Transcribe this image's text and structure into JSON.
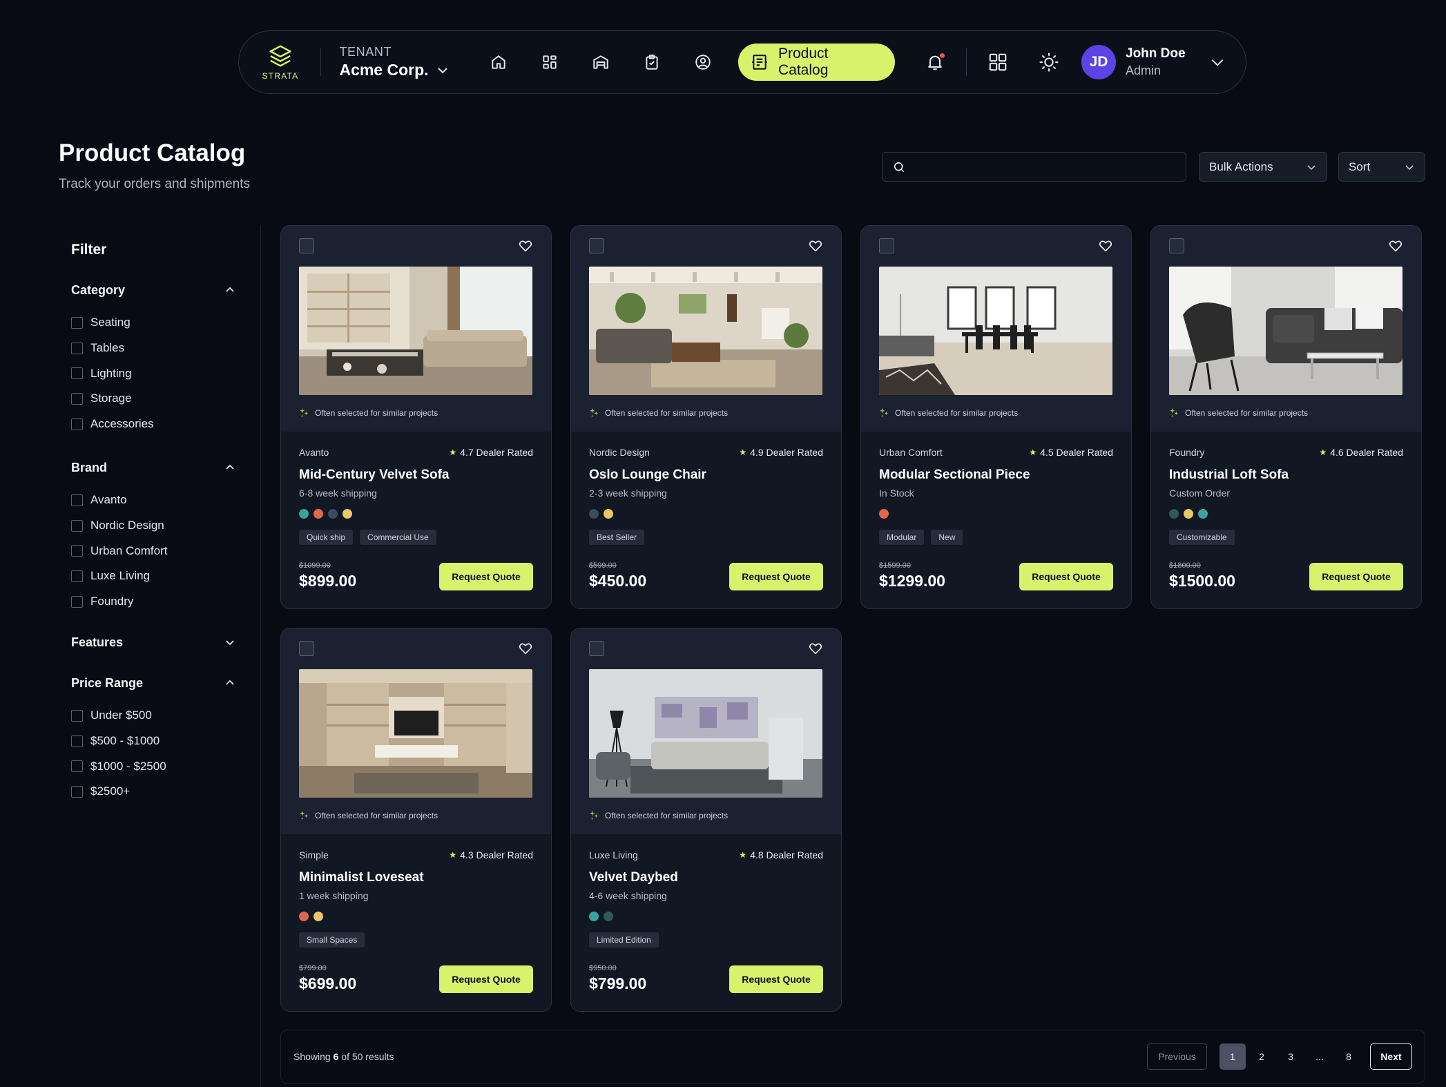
{
  "nav": {
    "logo_text": "STRATA",
    "tenant_label": "TENANT",
    "tenant_name": "Acme Corp.",
    "active_label": "Product Catalog",
    "user_initials": "JD",
    "user_name": "John Doe",
    "user_role": "Admin",
    "accent": "#d9f26b",
    "avatar_color": "#5b43e6"
  },
  "header": {
    "title": "Product Catalog",
    "subtitle": "Track your orders and shipments",
    "search_value": "",
    "bulk_label": "Bulk Actions",
    "sort_label": "Sort"
  },
  "filters": {
    "title": "Filter",
    "category": {
      "label": "Category",
      "options": [
        "Seating",
        "Tables",
        "Lighting",
        "Storage",
        "Accessories"
      ]
    },
    "brand": {
      "label": "Brand",
      "options": [
        "Avanto",
        "Nordic Design",
        "Urban Comfort",
        "Luxe Living",
        "Foundry"
      ]
    },
    "features": {
      "label": "Features"
    },
    "price": {
      "label": "Price Range",
      "options": [
        "Under $500",
        "$500 - $1000",
        "$1000 - $2500",
        "$2500+"
      ]
    }
  },
  "products": [
    {
      "brand": "Avanto",
      "rating": "4.7 Dealer Rated",
      "name": "Mid-Century Velvet Sofa",
      "shipping": "6-8 week shipping",
      "swatches": [
        "#3aa39a",
        "#e0674d",
        "#3b4b5e",
        "#eac765"
      ],
      "tags": [
        "Quick ship",
        "Commercial Use"
      ],
      "was": "$1099.00",
      "price": "$899.00",
      "note": "Often selected for similar projects",
      "cta": "Request Quote"
    },
    {
      "brand": "Nordic Design",
      "rating": "4.9 Dealer Rated",
      "name": "Oslo Lounge Chair",
      "shipping": "2-3 week shipping",
      "swatches": [
        "#3b4b5e",
        "#eac765"
      ],
      "tags": [
        "Best Seller"
      ],
      "was": "$599.00",
      "price": "$450.00",
      "note": "Often selected for similar projects",
      "cta": "Request Quote"
    },
    {
      "brand": "Urban Comfort",
      "rating": "4.5 Dealer Rated",
      "name": "Modular Sectional Piece",
      "shipping": "In Stock",
      "swatches": [
        "#e0674d"
      ],
      "tags": [
        "Modular",
        "New"
      ],
      "was": "$1599.00",
      "price": "$1299.00",
      "note": "Often selected for similar projects",
      "cta": "Request Quote"
    },
    {
      "brand": "Foundry",
      "rating": "4.6 Dealer Rated",
      "name": "Industrial Loft Sofa",
      "shipping": "Custom Order",
      "swatches": [
        "#2e5a57",
        "#eac765",
        "#3aa39a"
      ],
      "tags": [
        "Customizable"
      ],
      "was": "$1800.00",
      "price": "$1500.00",
      "note": "Often selected for similar projects",
      "cta": "Request Quote"
    },
    {
      "brand": "Simple",
      "rating": "4.3 Dealer Rated",
      "name": "Minimalist Loveseat",
      "shipping": "1 week shipping",
      "swatches": [
        "#e0674d",
        "#eac765"
      ],
      "tags": [
        "Small Spaces"
      ],
      "was": "$799.00",
      "price": "$699.00",
      "note": "Often selected for similar projects",
      "cta": "Request Quote"
    },
    {
      "brand": "Luxe Living",
      "rating": "4.8 Dealer Rated",
      "name": "Velvet Daybed",
      "shipping": "4-6 week shipping",
      "swatches": [
        "#3aa39a",
        "#2e5a57"
      ],
      "tags": [
        "Limited Edition"
      ],
      "was": "$950.00",
      "price": "$799.00",
      "note": "Often selected for similar projects",
      "cta": "Request Quote"
    }
  ],
  "pagination": {
    "showing_prefix": "Showing ",
    "showing_count": "6",
    "showing_suffix": " of 50 results",
    "prev": "Previous",
    "pages": [
      "1",
      "2",
      "3",
      "...",
      "8"
    ],
    "next": "Next"
  }
}
